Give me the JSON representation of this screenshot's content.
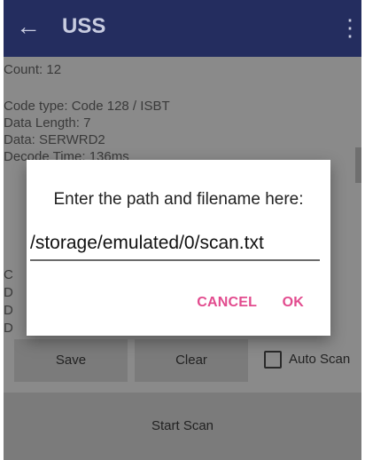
{
  "appbar": {
    "title": "USS",
    "back_icon": "arrow-left-icon",
    "overflow_icon": "more-vertical-icon",
    "colors": {
      "background": "#242d5f",
      "foreground": "#c8cce0"
    }
  },
  "content": {
    "count_label": "Count:  12",
    "info_lines": [
      "Code type: Code 128 / ISBT",
      "Data Length: 7",
      "Data: SERWRD2",
      "Decode Time: 136ms"
    ],
    "side_letters": [
      "C",
      "D",
      "D",
      "D"
    ]
  },
  "controls": {
    "save_label": "Save",
    "clear_label": "Clear",
    "auto_scan_label": "Auto Scan",
    "auto_scan_checked": false,
    "start_scan_label": "Start Scan"
  },
  "dialog": {
    "title": "Enter the path and filename here:",
    "path_value": "/storage/emulated/0/scan.txt",
    "cancel_label": "CANCEL",
    "ok_label": "OK",
    "accent_color": "#e24b8e"
  }
}
